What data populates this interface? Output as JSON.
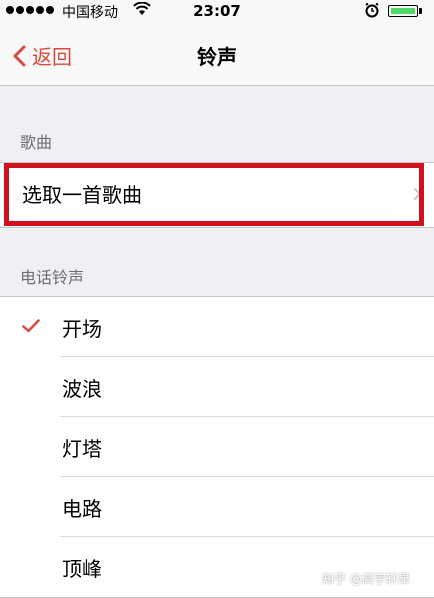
{
  "status": {
    "carrier": "中国移动",
    "time": "23:07"
  },
  "nav": {
    "back_label": "返回",
    "title": "铃声"
  },
  "songs": {
    "header": "歌曲",
    "pick_label": "选取一首歌曲"
  },
  "ringtones": {
    "header": "电话铃声",
    "items": [
      {
        "label": "开场",
        "selected": true
      },
      {
        "label": "波浪",
        "selected": false
      },
      {
        "label": "灯塔",
        "selected": false
      },
      {
        "label": "电路",
        "selected": false
      },
      {
        "label": "顶峰",
        "selected": false
      }
    ]
  },
  "watermark": "知乎 @高宇轩昂",
  "colors": {
    "accent": "#d9493f",
    "highlight": "#d0111b",
    "battery": "#4cd964"
  }
}
